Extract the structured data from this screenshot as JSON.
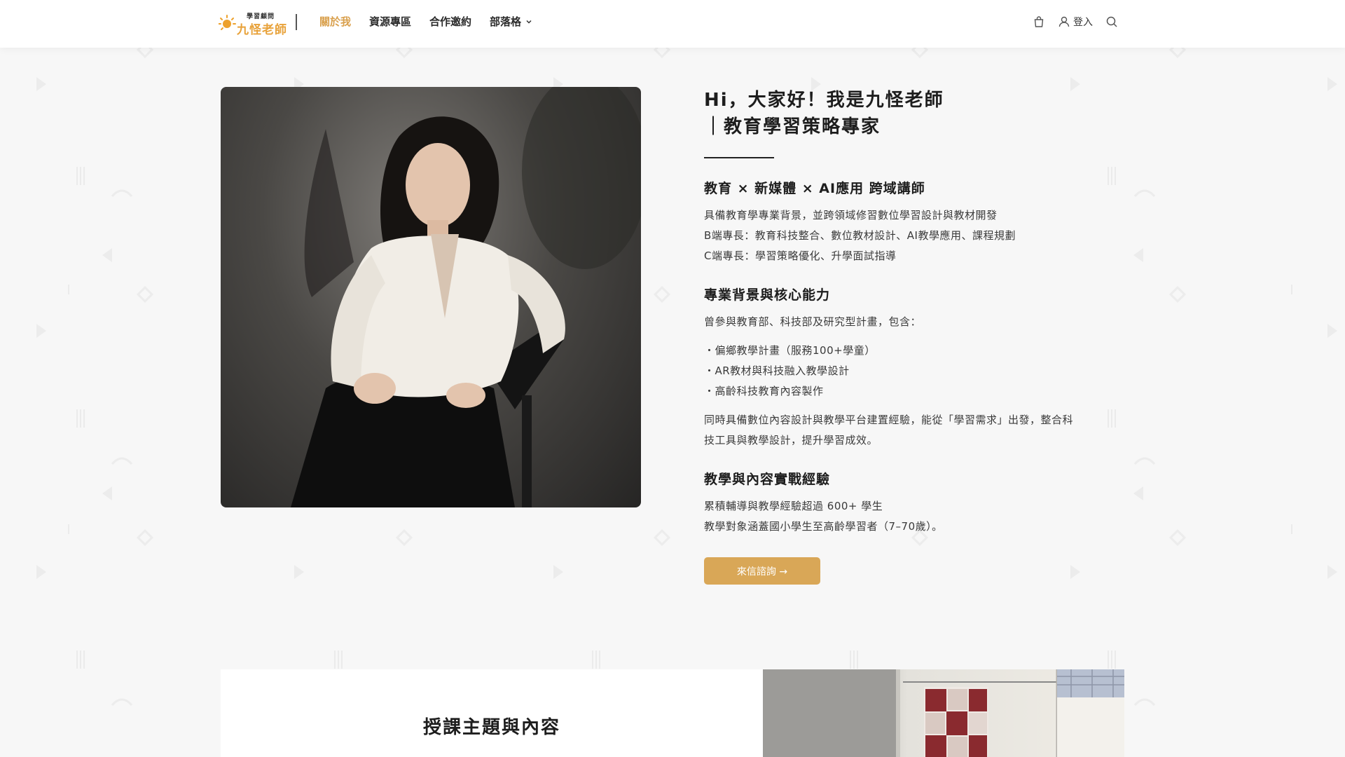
{
  "header": {
    "logo": {
      "top_text": "學習顧問",
      "main_text": "九怪老師"
    },
    "nav": [
      {
        "label": "關於我",
        "active": true
      },
      {
        "label": "資源專區",
        "active": false
      },
      {
        "label": "合作邀約",
        "active": false
      },
      {
        "label": "部落格",
        "active": false,
        "has_dropdown": true
      }
    ],
    "login_label": "登入",
    "icons": [
      "cart-icon",
      "user-icon",
      "search-icon"
    ]
  },
  "hero": {
    "title_line1": "Hi，大家好！我是九怪老師",
    "title_line2": "｜教育學習策略專家",
    "section1": {
      "title": "教育 × 新媒體 × AI應用 跨域講師",
      "lines": [
        "具備教育學專業背景，並跨領域修習數位學習設計與教材開發",
        "B端專長：教育科技整合、數位教材設計、AI教學應用、課程規劃",
        "C端專長：學習策略優化、升學面試指導"
      ]
    },
    "section2": {
      "title": "專業背景與核心能力",
      "intro": "曾參與教育部、科技部及研究型計畫，包含：",
      "bullets": [
        "・偏鄉教學計畫（服務100+學童）",
        "・AR教材與科技融入教學設計",
        "・高齡科技教育內容製作"
      ],
      "summary_line1": "同時具備數位內容設計與教學平台建置經驗，能從「學習需求」出發，整合科",
      "summary_line2": "技工具與教學設計，提升學習成效。"
    },
    "section3": {
      "title": "教學與內容實戰經驗",
      "lines": [
        "累積輔導與教學經驗超過 600+ 學生",
        "教學對象涵蓋國小學生至高齡學習者（7–70歲）。"
      ]
    },
    "cta_label": "來信諮詢 →"
  },
  "lower": {
    "title": "授課主題與內容"
  },
  "colors": {
    "accent": "#d9a757",
    "nav_active": "#d9a04d",
    "background": "#f7f7f7"
  }
}
